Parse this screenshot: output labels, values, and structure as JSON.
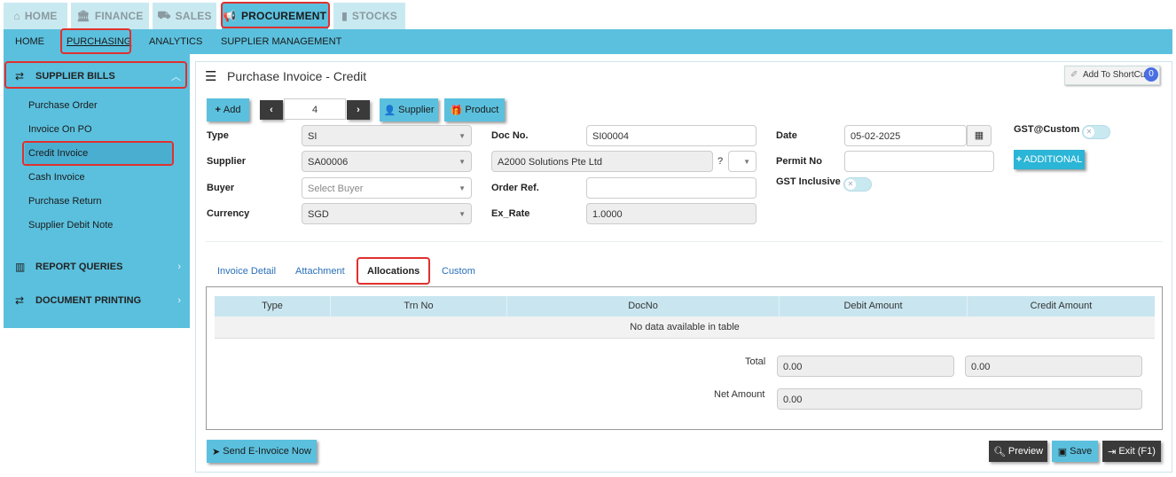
{
  "topnav": {
    "home": "HOME",
    "finance": "FINANCE",
    "sales": "SALES",
    "procurement": "PROCUREMENT",
    "stocks": "STOCKS"
  },
  "subnav": {
    "home": "HOME",
    "purchasing": "PURCHASING",
    "analytics": "ANALYTICS",
    "supplier_management": "SUPPLIER MANAGEMENT"
  },
  "sidebar": {
    "supplier_bills": "SUPPLIER BILLS",
    "items": [
      "Purchase Order",
      "Invoice On PO",
      "Credit Invoice",
      "Cash Invoice",
      "Purchase Return",
      "Supplier Debit Note"
    ],
    "report_queries": "REPORT QUERIES",
    "document_printing": "DOCUMENT PRINTING"
  },
  "page": {
    "title": "Purchase Invoice - Credit",
    "shortcut_label": "Add To ShortCut",
    "shortcut_count": "0"
  },
  "toolbar": {
    "add": "Add",
    "record_number": "4",
    "supplier": "Supplier",
    "product": "Product"
  },
  "form": {
    "type_label": "Type",
    "type_value": "SI",
    "supplier_label": "Supplier",
    "supplier_value": "SA00006",
    "buyer_label": "Buyer",
    "buyer_placeholder": "Select Buyer",
    "currency_label": "Currency",
    "currency_value": "SGD",
    "docno_label": "Doc No.",
    "docno_value": "SI00004",
    "supplier_name": "A2000 Solutions Pte Ltd",
    "question": "?",
    "orderref_label": "Order Ref.",
    "orderref_value": "",
    "exrate_label": "Ex_Rate",
    "exrate_value": "1.0000",
    "date_label": "Date",
    "date_value": "05-02-2025",
    "permit_label": "Permit No",
    "permit_value": "",
    "gst_inclusive_label": "GST Inclusive",
    "gst_custom_label": "GST@Custom",
    "additional_label": "ADDITIONAL"
  },
  "tabs": {
    "invoice_detail": "Invoice Detail",
    "attachment": "Attachment",
    "allocations": "Allocations",
    "custom": "Custom"
  },
  "table": {
    "columns": [
      "Type",
      "Trn No",
      "DocNo",
      "Debit Amount",
      "Credit Amount"
    ],
    "empty_message": "No data available in table"
  },
  "totals": {
    "total_label": "Total",
    "total_debit": "0.00",
    "total_credit": "0.00",
    "net_label": "Net Amount",
    "net_value": "0.00"
  },
  "footer": {
    "send_einvoice": "Send E-Invoice Now",
    "preview": "Preview",
    "save": "Save",
    "exit": "Exit (F1)"
  }
}
